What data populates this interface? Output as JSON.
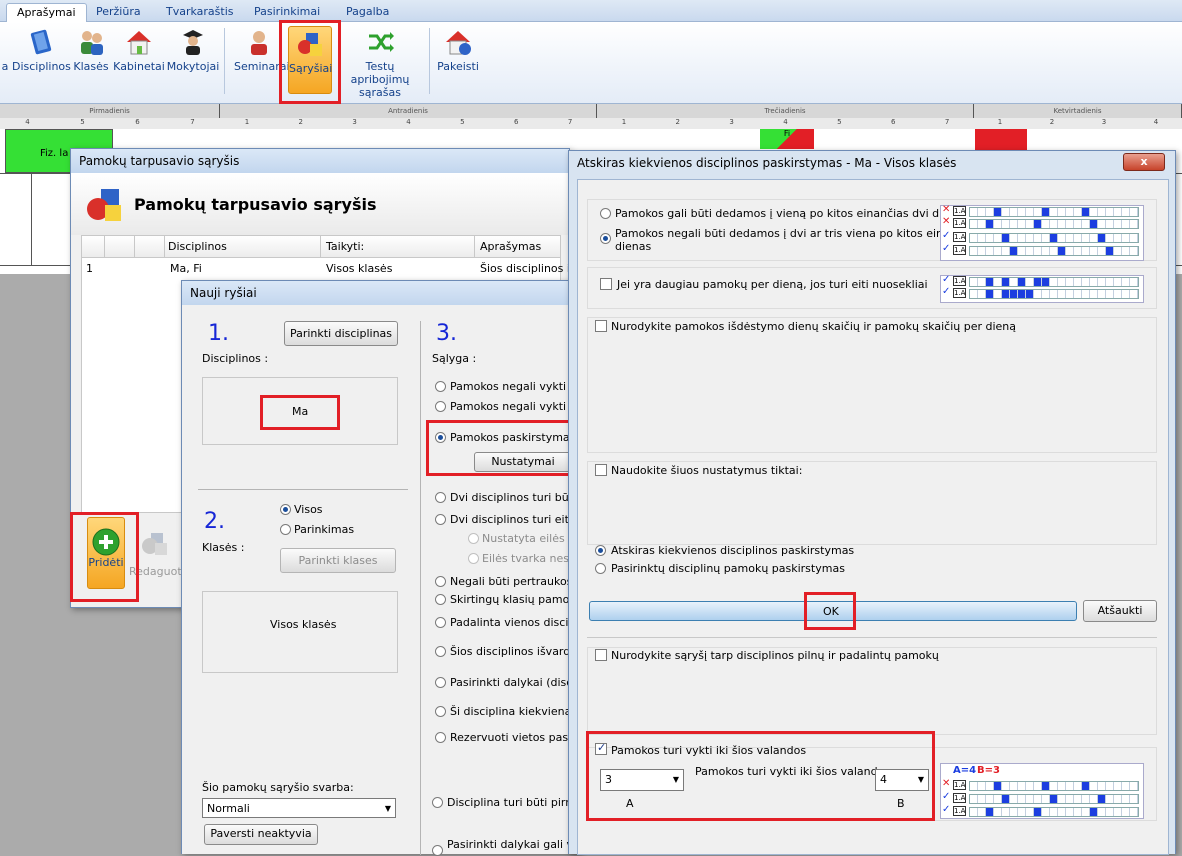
{
  "menu": {
    "tabs": [
      "Aprašymai",
      "Peržiūra",
      "Tvarkaraštis",
      "Pasirinkimai",
      "Pagalba"
    ]
  },
  "ribbon": {
    "buttons": [
      "a",
      "Disciplinos",
      "Klasės",
      "Kabinetai",
      "Mokytojai",
      "Seminarai",
      "Sąryšiai",
      "Testų apribojimų sąrašas",
      "Pakeisti"
    ],
    "sarysiai_line1": "Testų apribojimų",
    "sarysiai_line2": "sąrašas"
  },
  "timetable": {
    "days": [
      "Pirmadienis",
      "Antradienis",
      "Trečiadienis",
      "Ketvirtadienis"
    ],
    "mon_nums": [
      "4",
      "5",
      "6",
      "7"
    ],
    "nums": [
      "1",
      "2",
      "3",
      "4",
      "5",
      "6",
      "7"
    ],
    "thu_nums": [
      "1",
      "2",
      "3",
      "4"
    ],
    "cell_fiz": "Fiz. la",
    "cell_fi": "Fi"
  },
  "relations_window": {
    "title": "Pamokų tarpusavio sąryšis",
    "header": "Pamokų tarpusavio sąryšis",
    "columns": [
      "Disciplinos",
      "Taikyti:",
      "Aprašymas"
    ],
    "rows": [
      {
        "num": "1",
        "disc": "Ma, Fi",
        "apply": "Visos klasės",
        "desc": "Šios disciplinos i"
      }
    ],
    "add_label": "Pridėti",
    "edit_label": "Redaguoti"
  },
  "new_window": {
    "title": "Nauji ryšiai",
    "step1": "1.",
    "step2": "2.",
    "step3": "3.",
    "pick_disc_btn": "Parinkti disciplinas",
    "disc_label": "Disciplinos :",
    "disc_value": "Ma",
    "classes_label": "Klasės :",
    "opt_all": "Visos",
    "opt_pick": "Parinkimas",
    "pick_classes_btn": "Parinkti klases",
    "classes_value": "Visos klasės",
    "cond_label": "Sąlyga :",
    "conditions": [
      "Pamokos negali vykti tą p",
      "Pamokos negali vykti tą p",
      "Pamokos paskirstymas pe",
      "Dvi disciplinos turi būti tą",
      "Dvi disciplinos turi eiti vie",
      "Nustatyta eilės tv",
      "Eilės tvarka nesva",
      "Negali būti pertraukos ta",
      "Skirtingų klasių pamokų g",
      "Padalinta vienos disciplin",
      "Šios disciplinos išvardinto",
      "Pasirinkti dalykai (disciplin",
      "Ši disciplina kiekvieną turi",
      "Rezervuoti vietos pasirin",
      "Disciplina turi būti pirma a",
      "Pasirinkti dalykai gali vykt"
    ],
    "settings_btn": "Nustatymai",
    "weight_label": "Šio pamokų sąryšio svarba:",
    "weight_value": "Normali",
    "deactivate_btn": "Paversti neaktyvia"
  },
  "dist_window": {
    "title": "Atskiras kiekvienos disciplinos paskirstymas - Ma - Visos klasės",
    "opt1": "Pamokos gali būti dedamos į vieną po kitos einančias dvi dienas",
    "opt2a": "Pamokos negali būti dedamos į dvi ar tris viena po kitos einančias",
    "opt2b": "dienas",
    "chk_seq": "Jei yra daugiau pamokų per dieną, jos turi eiti nuosekliai",
    "chk_days": "Nurodykite pamokos išdėstymo dienų skaičių ir pamokų skaičių per dieną",
    "chk_only": "Naudokite šiuos nustatymus tiktai:",
    "opt_sep": "Atskiras kiekvienos disciplinos paskirstymas",
    "opt_chosen": "Pasirinktų disciplinų pamokų paskirstymas",
    "ok": "OK",
    "cancel": "Atšaukti",
    "chk_rel": "Nurodykite sąryšį tarp disciplinos pilnų ir padalintų pamokų",
    "chk_until": "Pamokos turi vykti iki šios valandos",
    "until_mid": "Pamokos turi vykti iki šios valandos",
    "sel_a": "3",
    "sel_b": "4",
    "lbl_a": "A",
    "lbl_b": "B",
    "legend_a": "A=4",
    "legend_b": "B=3",
    "strip_label": "1.A",
    "close": "x"
  }
}
